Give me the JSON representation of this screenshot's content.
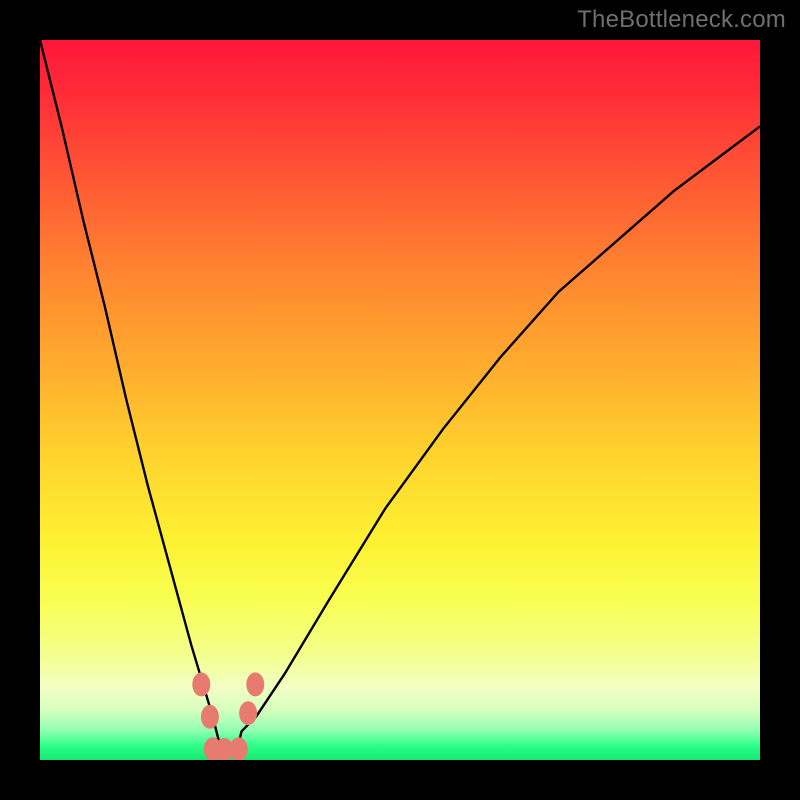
{
  "watermark_text": "TheBottleneck.com",
  "colors": {
    "frame": "#000000",
    "curve": "#000000",
    "marker": "#e87b6f",
    "gradient_top": "#ff163a",
    "gradient_bottom": "#14e871"
  },
  "chart_data": {
    "type": "line",
    "title": "",
    "xlabel": "",
    "ylabel": "",
    "xlim": [
      0,
      100
    ],
    "ylim": [
      0,
      100
    ],
    "grid": false,
    "legend": false,
    "note": "V-shaped bottleneck curve over a red→yellow→green background. Minimum is near the bottom (green band). Values are estimated from pixel positions; no axis ticks or labels are shown.",
    "series": [
      {
        "name": "bottleneck-curve",
        "x": [
          0,
          3,
          6,
          9,
          12,
          15,
          18,
          21,
          24,
          24.5,
          25,
          27.5,
          28,
          30,
          34,
          40,
          48,
          56,
          64,
          72,
          80,
          88,
          96,
          100
        ],
        "y": [
          100,
          88,
          75,
          63,
          50,
          38,
          27,
          16,
          6,
          4,
          2,
          2,
          4,
          6,
          12,
          22,
          35,
          46,
          56,
          65,
          72,
          79,
          85,
          88
        ]
      }
    ],
    "markers": [
      {
        "name": "left-upper",
        "x": 22.4,
        "y": 10.5
      },
      {
        "name": "left-lower",
        "x": 23.6,
        "y": 6.0
      },
      {
        "name": "right-upper",
        "x": 29.9,
        "y": 10.5
      },
      {
        "name": "right-lower",
        "x": 28.9,
        "y": 6.5
      },
      {
        "name": "bottom-a",
        "x": 24.0,
        "y": 1.5
      },
      {
        "name": "bottom-b",
        "x": 25.6,
        "y": 1.4
      },
      {
        "name": "bottom-c",
        "x": 27.6,
        "y": 1.5
      }
    ]
  }
}
